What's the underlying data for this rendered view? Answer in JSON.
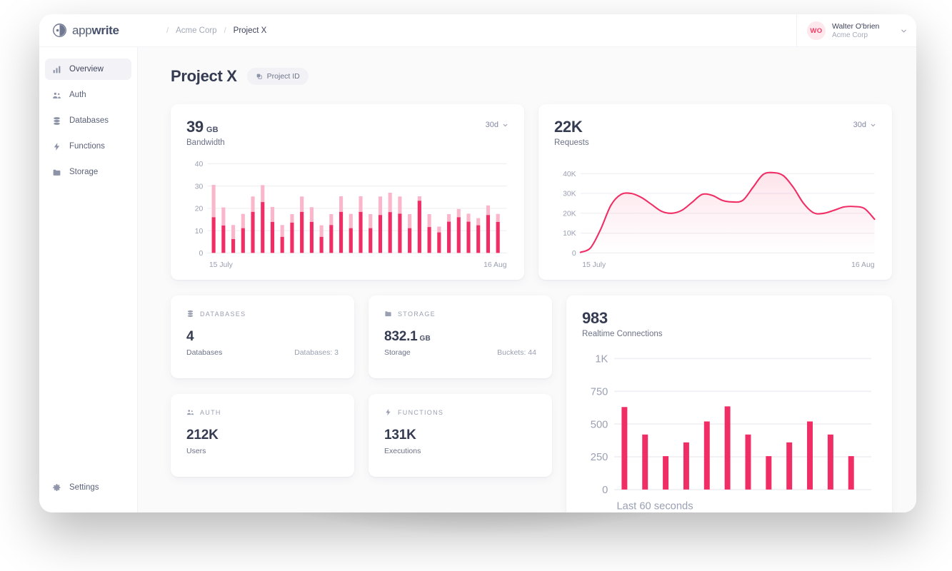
{
  "brand": {
    "name_light": "app",
    "name_bold": "write",
    "logo_icon": "appwrite-logo-icon"
  },
  "breadcrumb": {
    "org": "Acme Corp",
    "sep": "/",
    "project": "Project X"
  },
  "user": {
    "initials": "WO",
    "name": "Walter O'brien",
    "org": "Acme Corp",
    "chevron": "chevron-down-icon"
  },
  "sidebar": {
    "items": [
      {
        "label": "Overview",
        "icon": "bar-chart-icon",
        "active": true
      },
      {
        "label": "Auth",
        "icon": "users-icon",
        "active": false
      },
      {
        "label": "Databases",
        "icon": "database-icon",
        "active": false
      },
      {
        "label": "Functions",
        "icon": "lightning-icon",
        "active": false
      },
      {
        "label": "Storage",
        "icon": "folder-icon",
        "active": false
      }
    ],
    "footer": {
      "label": "Settings",
      "icon": "gear-icon"
    }
  },
  "page": {
    "title": "Project X",
    "badge_label": "Project ID",
    "badge_icon": "copy-icon"
  },
  "colors": {
    "accent": "#f02e65",
    "accent_light": "#fab6ca",
    "text_dark": "#353b51",
    "text_muted": "#6b7286",
    "axis": "#9aa0b2",
    "grid": "#f0f0f4",
    "bg_main": "#fafafb"
  },
  "cards": {
    "bandwidth": {
      "value": "39",
      "unit": "GB",
      "label": "Bandwidth",
      "range": "30d",
      "range_chevron": "chevron-down-icon"
    },
    "requests": {
      "value": "22K",
      "unit": "",
      "label": "Requests",
      "range": "30d",
      "range_chevron": "chevron-down-icon"
    },
    "databases": {
      "head": "DATABASES",
      "icon": "database-icon",
      "value": "4",
      "unit": "",
      "sub": "Databases",
      "aux": "Databases: 3"
    },
    "storage": {
      "head": "STORAGE",
      "icon": "folder-icon",
      "value": "832.1",
      "unit": "GB",
      "sub": "Storage",
      "aux": "Buckets: 44"
    },
    "auth": {
      "head": "AUTH",
      "icon": "users-icon",
      "value": "212K",
      "unit": "",
      "sub": "Users",
      "aux": ""
    },
    "functions": {
      "head": "FUNCTIONS",
      "icon": "lightning-icon",
      "value": "131K",
      "unit": "",
      "sub": "Executions",
      "aux": ""
    },
    "realtime": {
      "value": "983",
      "label": "Realtime Connections"
    }
  },
  "chart_data": [
    {
      "id": "bandwidth",
      "type": "bar",
      "stacked": true,
      "title": "Bandwidth",
      "xlabel": "",
      "ylabel": "",
      "ylim": [
        0,
        40
      ],
      "yticks": [
        0,
        10,
        20,
        30,
        40
      ],
      "ytick_labels": [
        "0",
        "10",
        "20",
        "30",
        "40"
      ],
      "grid": true,
      "x_axis_start_label": "15 July",
      "x_axis_end_label": "16 Aug",
      "series": [
        {
          "name": "used",
          "color": "#f02e65",
          "values": [
            16.0,
            12.3,
            6.2,
            11.1,
            18.4,
            22.8,
            13.9,
            7.2,
            13.6,
            18.4,
            13.9,
            7.2,
            12.5,
            18.4,
            11.1,
            18.4,
            11.1,
            17.0,
            18.3,
            17.6,
            11.1,
            23.4,
            11.6,
            9.2,
            14.0,
            16.0,
            14.0,
            12.4,
            17.0,
            13.9
          ]
        },
        {
          "name": "total",
          "color": "#fab6ca",
          "values": [
            30.5,
            20.4,
            12.5,
            17.5,
            25.3,
            30.4,
            20.6,
            12.5,
            17.4,
            25.3,
            20.5,
            12.4,
            17.4,
            25.4,
            17.5,
            25.4,
            17.4,
            25.3,
            27.0,
            25.3,
            17.4,
            25.4,
            17.4,
            11.8,
            17.4,
            19.7,
            17.6,
            15.6,
            21.3,
            17.5
          ]
        }
      ]
    },
    {
      "id": "requests",
      "type": "line",
      "title": "Requests",
      "xlabel": "",
      "ylabel": "",
      "ylim": [
        0,
        45000
      ],
      "yticks": [
        0,
        10000,
        20000,
        30000,
        40000
      ],
      "ytick_labels": [
        "0",
        "10K",
        "20K",
        "30K",
        "40K"
      ],
      "grid": true,
      "x_axis_start_label": "15 July",
      "x_axis_end_label": "16 Aug",
      "series": [
        {
          "name": "requests",
          "color": "#f02e65",
          "values": [
            300,
            2600,
            12000,
            24000,
            29500,
            30000,
            28000,
            24500,
            21000,
            20000,
            21500,
            25500,
            29500,
            29000,
            26500,
            25700,
            26500,
            33000,
            39500,
            40500,
            39000,
            33000,
            25000,
            20200,
            20000,
            21500,
            23200,
            23400,
            22400,
            17000
          ]
        }
      ]
    },
    {
      "id": "realtime",
      "type": "bar",
      "stacked": false,
      "title": "Realtime Connections",
      "xlabel": "Last 60 seconds",
      "ylabel": "",
      "ylim": [
        0,
        1000
      ],
      "yticks": [
        0,
        250,
        500,
        750,
        1000
      ],
      "ytick_labels": [
        "0",
        "250",
        "500",
        "750",
        "1K"
      ],
      "grid": true,
      "series": [
        {
          "name": "connections",
          "color": "#f02e65",
          "values": [
            630,
            420,
            255,
            360,
            520,
            635,
            420,
            255,
            360,
            520,
            420,
            255
          ]
        }
      ]
    }
  ]
}
